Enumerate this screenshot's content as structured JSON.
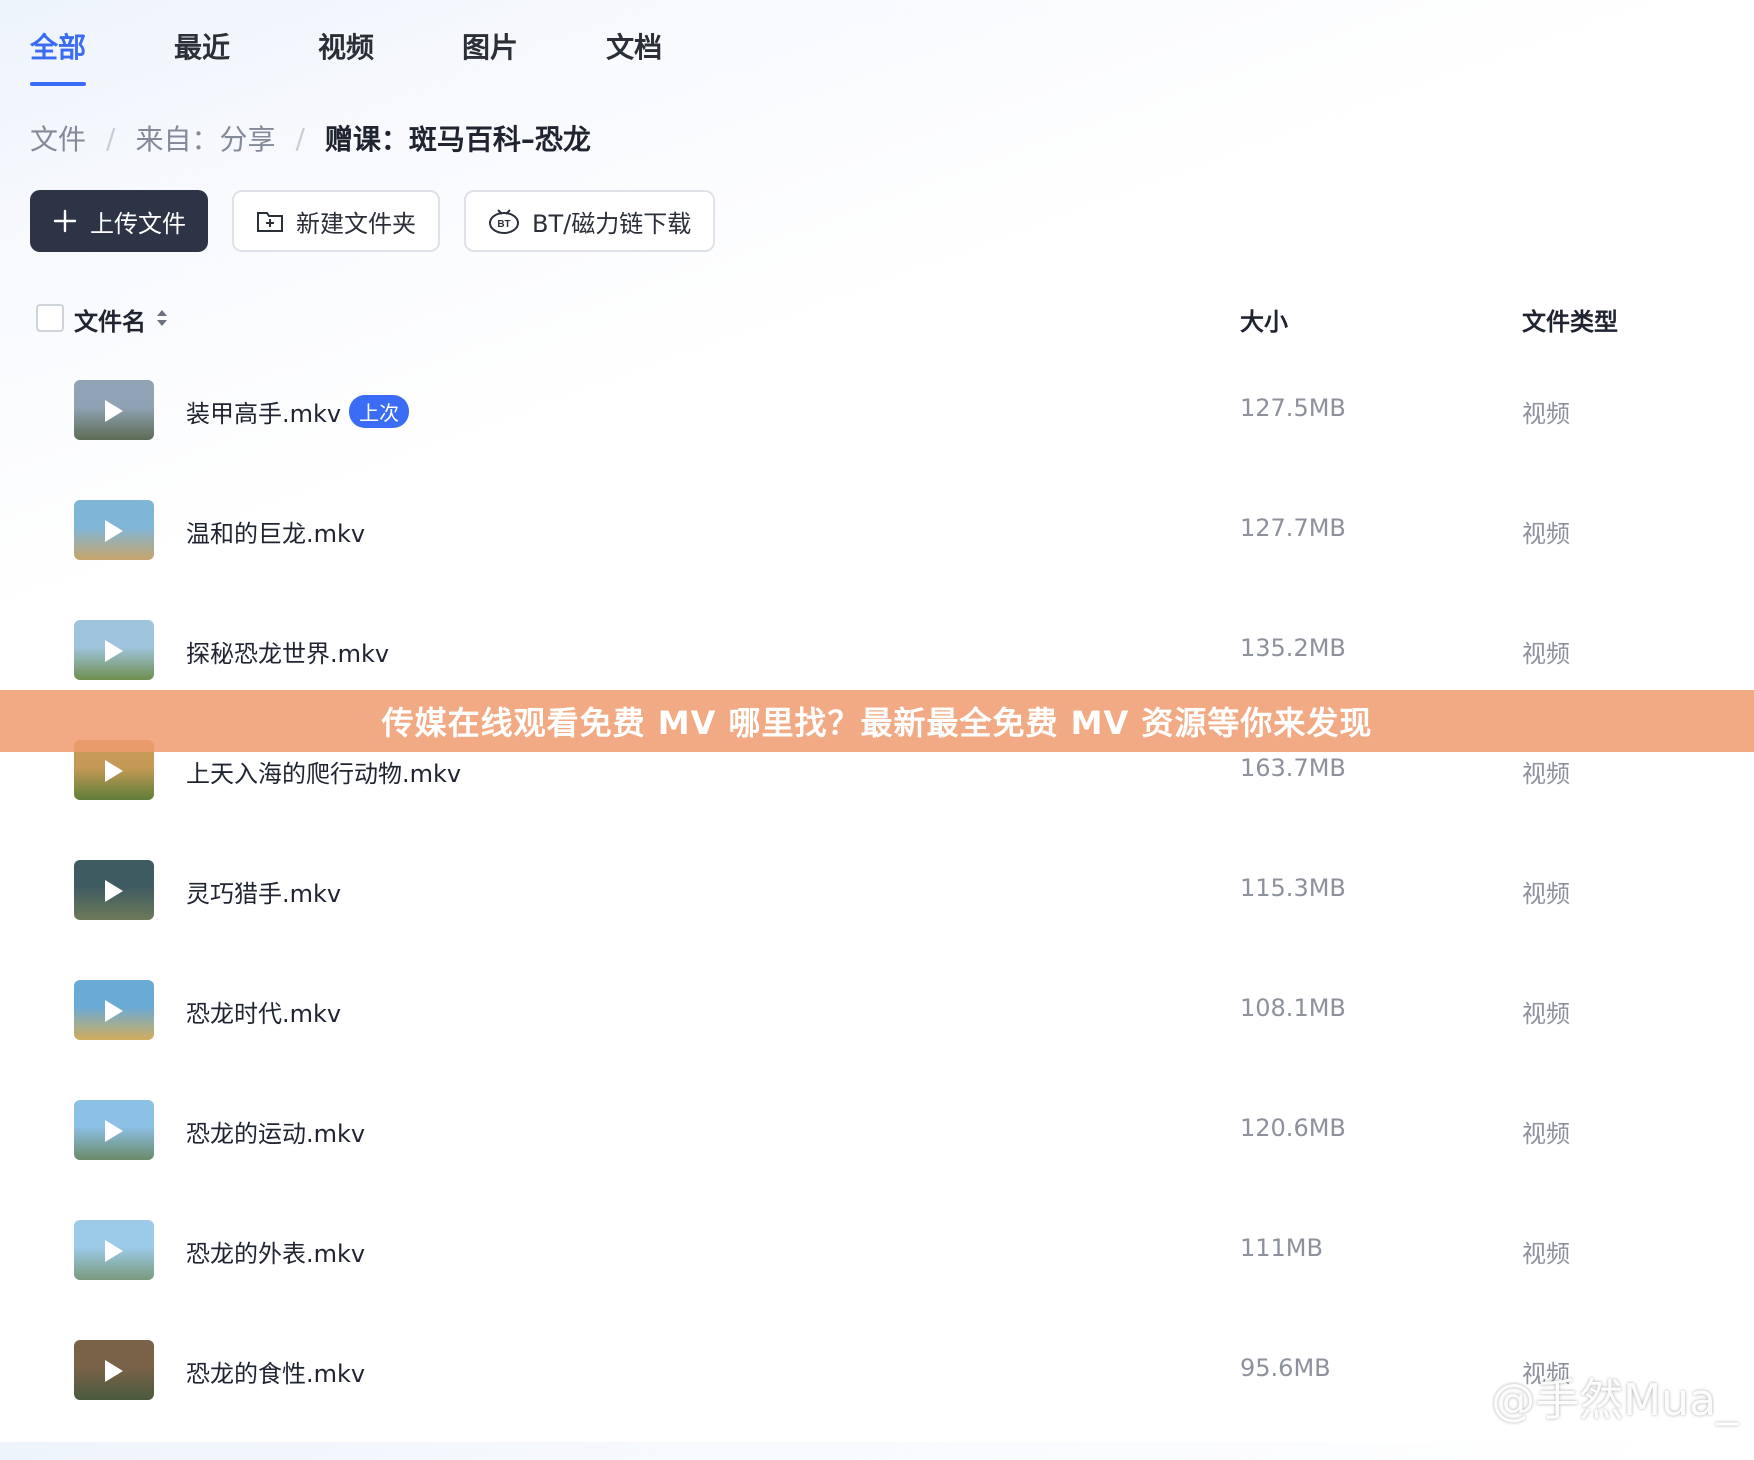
{
  "tabs": [
    {
      "label": "全部",
      "active": true
    },
    {
      "label": "最近",
      "active": false
    },
    {
      "label": "视频",
      "active": false
    },
    {
      "label": "图片",
      "active": false
    },
    {
      "label": "文档",
      "active": false
    }
  ],
  "breadcrumb": {
    "items": [
      "文件",
      "来自：分享",
      "赠课：斑马百科–恐龙"
    ],
    "separator": "/"
  },
  "toolbar": {
    "upload_label": "上传文件",
    "new_folder_label": "新建文件夹",
    "bt_label": "BT/磁力链下载",
    "bt_icon_text": "BT"
  },
  "table": {
    "headers": {
      "name": "文件名",
      "size": "大小",
      "type": "文件类型"
    },
    "rows": [
      {
        "name": "装甲高手.mkv",
        "badge": "上次",
        "size": "127.5MB",
        "type": "视频"
      },
      {
        "name": "温和的巨龙.mkv",
        "size": "127.7MB",
        "type": "视频"
      },
      {
        "name": "探秘恐龙世界.mkv",
        "size": "135.2MB",
        "type": "视频"
      },
      {
        "name": "上天入海的爬行动物.mkv",
        "size": "163.7MB",
        "type": "视频"
      },
      {
        "name": "灵巧猎手.mkv",
        "size": "115.3MB",
        "type": "视频"
      },
      {
        "name": "恐龙时代.mkv",
        "size": "108.1MB",
        "type": "视频"
      },
      {
        "name": "恐龙的运动.mkv",
        "size": "120.6MB",
        "type": "视频"
      },
      {
        "name": "恐龙的外表.mkv",
        "size": "111MB",
        "type": "视频"
      },
      {
        "name": "恐龙的食性.mkv",
        "size": "95.6MB",
        "type": "视频"
      }
    ]
  },
  "banner": {
    "text": "传媒在线观看免费 MV 哪里找？最新最全免费 MV 资源等你来发现"
  },
  "watermark": {
    "text": "@手然Mua_"
  },
  "colors": {
    "accent": "#3b6cf6",
    "primary_button": "#2c3446",
    "banner": "#f09b6e"
  }
}
